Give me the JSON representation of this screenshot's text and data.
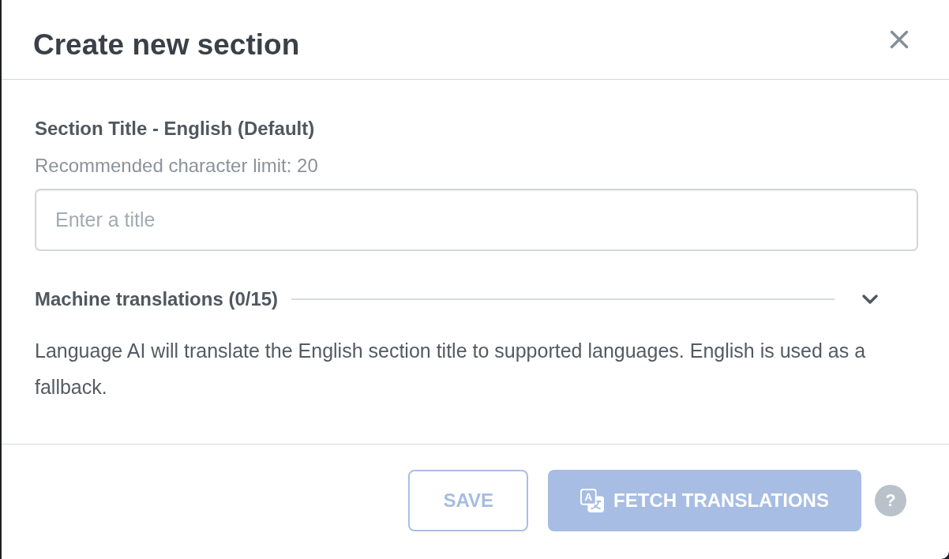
{
  "dialog": {
    "title": "Create new section"
  },
  "field": {
    "label": "Section Title - English (Default)",
    "hint": "Recommended character limit: 20",
    "placeholder": "Enter a title"
  },
  "machine_translations": {
    "heading": "Machine translations (0/15)",
    "expanded": false,
    "description": "Language AI will translate the English section title to supported languages. English is used as a fallback."
  },
  "footer": {
    "buttons": [
      {
        "kind": "outline",
        "label": "SAVE",
        "disabled": true
      },
      {
        "kind": "primary",
        "label": "FETCH TRANSLATIONS",
        "disabled": true
      }
    ],
    "help_button": {
      "label": "?"
    }
  }
}
